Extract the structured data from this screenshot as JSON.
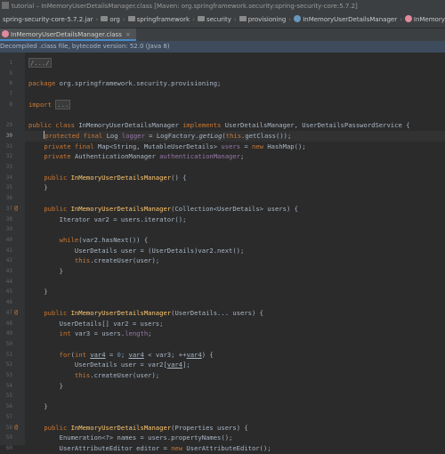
{
  "title_bar": {
    "text": "tutorial – InMemoryUserDetailsManager.class [Maven: org.springframework.security:spring-security-core:5.7.2]"
  },
  "breadcrumb": [
    {
      "label": "spring-security-core-5.7.2.jar",
      "kind": "jar"
    },
    {
      "label": "org",
      "kind": "folder"
    },
    {
      "label": "springframework",
      "kind": "folder"
    },
    {
      "label": "security",
      "kind": "folder"
    },
    {
      "label": "provisioning",
      "kind": "folder"
    },
    {
      "label": "InMemoryUserDetailsManager",
      "kind": "class"
    },
    {
      "label": "InMemoryUserDetailsManager",
      "kind": "method"
    }
  ],
  "tab": {
    "label": "InMemoryUserDetailsManager.class",
    "close": "×"
  },
  "banner": {
    "text": "Decompiled .class file, bytecode version: 52.0 (Java 8)"
  },
  "current_line": "30",
  "code": [
    {
      "n": "1",
      "mark": "",
      "t": [
        [
          "fold",
          "/.../"
        ]
      ]
    },
    {
      "n": "5",
      "mark": "",
      "t": []
    },
    {
      "n": "6",
      "mark": "",
      "t": [
        [
          "kw",
          "package "
        ],
        [
          "p",
          "org.springframework.security.provisioning;"
        ]
      ]
    },
    {
      "n": "7",
      "mark": "",
      "t": []
    },
    {
      "n": "8",
      "mark": "",
      "t": [
        [
          "kw",
          "import "
        ],
        [
          "fold",
          "..."
        ]
      ]
    },
    {
      "n": "",
      "mark": "",
      "t": []
    },
    {
      "n": "29",
      "mark": "",
      "t": [
        [
          "kw",
          "public class "
        ],
        [
          "p",
          "InMemoryUserDetailsManager "
        ],
        [
          "kw",
          "implements "
        ],
        [
          "p",
          "UserDetailsManager, UserDetailsPasswordService {"
        ]
      ]
    },
    {
      "n": "30",
      "mark": "",
      "t": [
        [
          "p",
          "    "
        ],
        [
          "kw",
          "protected final "
        ],
        [
          "p",
          "Log "
        ],
        [
          "fld",
          "logger"
        ],
        [
          "p",
          " = LogFactory."
        ],
        [
          "it",
          "getLog"
        ],
        [
          "p",
          "("
        ],
        [
          "kw",
          "this"
        ],
        [
          "p",
          ".getClass());"
        ]
      ]
    },
    {
      "n": "31",
      "mark": "",
      "t": [
        [
          "p",
          "    "
        ],
        [
          "kw",
          "private final "
        ],
        [
          "p",
          "Map<String, MutableUserDetails> "
        ],
        [
          "fld",
          "users"
        ],
        [
          "p",
          " = "
        ],
        [
          "kw",
          "new "
        ],
        [
          "p",
          "HashMap();"
        ]
      ]
    },
    {
      "n": "32",
      "mark": "",
      "t": [
        [
          "p",
          "    "
        ],
        [
          "kw",
          "private "
        ],
        [
          "p",
          "AuthenticationManager "
        ],
        [
          "fld",
          "authenticationManager"
        ],
        [
          "p",
          ";"
        ]
      ]
    },
    {
      "n": "33",
      "mark": "",
      "t": []
    },
    {
      "n": "34",
      "mark": "",
      "t": [
        [
          "p",
          "    "
        ],
        [
          "kw",
          "public "
        ],
        [
          "fn",
          "InMemoryUserDetailsManager"
        ],
        [
          "p",
          "() {"
        ]
      ]
    },
    {
      "n": "35",
      "mark": "",
      "t": [
        [
          "p",
          "    }"
        ]
      ]
    },
    {
      "n": "36",
      "mark": "",
      "t": []
    },
    {
      "n": "37",
      "mark": "@",
      "t": [
        [
          "p",
          "    "
        ],
        [
          "kw",
          "public "
        ],
        [
          "fn",
          "InMemoryUserDetailsManager"
        ],
        [
          "p",
          "(Collection<UserDetails> users) {"
        ]
      ]
    },
    {
      "n": "38",
      "mark": "",
      "t": [
        [
          "p",
          "        Iterator var2 = users.iterator();"
        ]
      ]
    },
    {
      "n": "39",
      "mark": "",
      "t": []
    },
    {
      "n": "40",
      "mark": "",
      "t": [
        [
          "p",
          "        "
        ],
        [
          "kw",
          "while"
        ],
        [
          "p",
          "(var2.hasNext()) {"
        ]
      ]
    },
    {
      "n": "41",
      "mark": "",
      "t": [
        [
          "p",
          "            UserDetails user = (UserDetails)var2.next();"
        ]
      ]
    },
    {
      "n": "42",
      "mark": "",
      "t": [
        [
          "p",
          "            "
        ],
        [
          "kw",
          "this"
        ],
        [
          "p",
          ".createUser(user);"
        ]
      ]
    },
    {
      "n": "43",
      "mark": "",
      "t": [
        [
          "p",
          "        }"
        ]
      ]
    },
    {
      "n": "44",
      "mark": "",
      "t": []
    },
    {
      "n": "45",
      "mark": "",
      "t": [
        [
          "p",
          "    }"
        ]
      ]
    },
    {
      "n": "46",
      "mark": "",
      "t": []
    },
    {
      "n": "47",
      "mark": "@",
      "t": [
        [
          "p",
          "    "
        ],
        [
          "kw",
          "public "
        ],
        [
          "fn",
          "InMemoryUserDetailsManager"
        ],
        [
          "p",
          "(UserDetails... users) {"
        ]
      ]
    },
    {
      "n": "48",
      "mark": "",
      "t": [
        [
          "p",
          "        UserDetails[] var2 = users;"
        ]
      ]
    },
    {
      "n": "49",
      "mark": "",
      "t": [
        [
          "p",
          "        "
        ],
        [
          "kw",
          "int "
        ],
        [
          "p",
          "var3 = users."
        ],
        [
          "fld",
          "length"
        ],
        [
          "p",
          ";"
        ]
      ]
    },
    {
      "n": "50",
      "mark": "",
      "t": []
    },
    {
      "n": "51",
      "mark": "",
      "t": [
        [
          "p",
          "        "
        ],
        [
          "kw",
          "for"
        ],
        [
          "p",
          "("
        ],
        [
          "kw",
          "int "
        ],
        [
          "ul",
          "var4"
        ],
        [
          "p",
          " = "
        ],
        [
          "num",
          "0"
        ],
        [
          "p",
          "; "
        ],
        [
          "ul",
          "var4"
        ],
        [
          "p",
          " < var3; ++"
        ],
        [
          "ul",
          "var4"
        ],
        [
          "p",
          ") {"
        ]
      ]
    },
    {
      "n": "52",
      "mark": "",
      "t": [
        [
          "p",
          "            UserDetails user = var2["
        ],
        [
          "ul",
          "var4"
        ],
        [
          "p",
          "];"
        ]
      ]
    },
    {
      "n": "53",
      "mark": "",
      "t": [
        [
          "p",
          "            "
        ],
        [
          "kw",
          "this"
        ],
        [
          "p",
          ".createUser(user);"
        ]
      ]
    },
    {
      "n": "54",
      "mark": "",
      "t": [
        [
          "p",
          "        }"
        ]
      ]
    },
    {
      "n": "55",
      "mark": "",
      "t": []
    },
    {
      "n": "56",
      "mark": "",
      "t": [
        [
          "p",
          "    }"
        ]
      ]
    },
    {
      "n": "57",
      "mark": "",
      "t": []
    },
    {
      "n": "58",
      "mark": "@",
      "t": [
        [
          "p",
          "    "
        ],
        [
          "kw",
          "public "
        ],
        [
          "fn",
          "InMemoryUserDetailsManager"
        ],
        [
          "p",
          "(Properties users) {"
        ]
      ]
    },
    {
      "n": "59",
      "mark": "",
      "t": [
        [
          "p",
          "        Enumeration<?> names = users.propertyNames();"
        ]
      ]
    },
    {
      "n": "60",
      "mark": "",
      "t": [
        [
          "p",
          "        UserAttributeEditor editor = "
        ],
        [
          "kw",
          "new "
        ],
        [
          "p",
          "UserAttributeEditor();"
        ]
      ]
    }
  ],
  "colors": {
    "background": "#2b2b2b",
    "keyword": "#cc7832",
    "method": "#ffc66d",
    "field": "#9876aa",
    "number": "#6897bb",
    "text": "#a9b7c6"
  }
}
